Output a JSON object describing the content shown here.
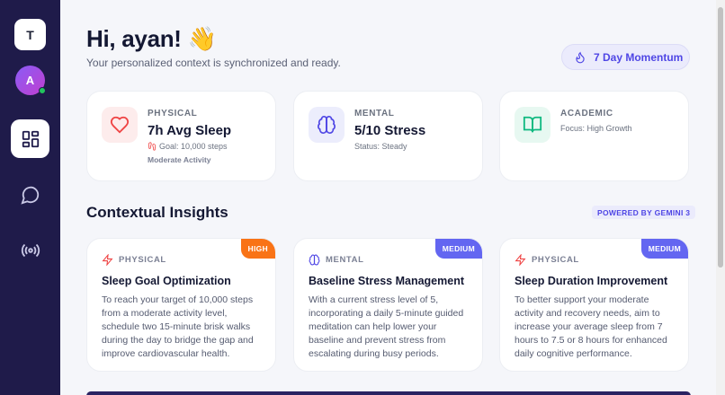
{
  "sidebar": {
    "logo_letter": "T",
    "avatar_letter": "A"
  },
  "header": {
    "greeting": "Hi, ayan! 👋",
    "subtitle": "Your personalized context is synchronized and ready.",
    "momentum_label": "7 Day Momentum"
  },
  "context_cards": [
    {
      "category": "PHYSICAL",
      "title": "7h Avg Sleep",
      "detail": "Goal: 10,000 steps",
      "note": "Moderate Activity",
      "icon": "heart-icon",
      "accent": "#ef4444"
    },
    {
      "category": "MENTAL",
      "title": "5/10 Stress",
      "detail": "Status: Steady",
      "icon": "brain-icon",
      "accent": "#4f46e5"
    },
    {
      "category": "ACADEMIC",
      "detail": "Focus: High Growth",
      "icon": "book-icon",
      "accent": "#10b981"
    }
  ],
  "insights": {
    "title": "Contextual Insights",
    "powered_by": "POWERED BY GEMINI 3",
    "cards": [
      {
        "category": "PHYSICAL",
        "priority": "HIGH",
        "priority_color": "#f97316",
        "title": "Sleep Goal Optimization",
        "body": "To reach your target of 10,000 steps from a moderate activity level, schedule two 15-minute brisk walks during the day to bridge the gap and improve cardiovascular health.",
        "icon": "lightning-icon"
      },
      {
        "category": "MENTAL",
        "priority": "MEDIUM",
        "priority_color": "#6366f1",
        "title": "Baseline Stress Management",
        "body": "With a current stress level of 5, incorporating a daily 5-minute guided meditation can help lower your baseline and prevent stress from escalating during busy periods.",
        "icon": "brain-icon"
      },
      {
        "category": "PHYSICAL",
        "priority": "MEDIUM",
        "priority_color": "#6366f1",
        "title": "Sleep Duration Improvement",
        "body": "To better support your moderate activity and recovery needs, aim to increase your average sleep from 7 hours to 7.5 or 8 hours for enhanced daily cognitive performance.",
        "icon": "lightning-icon"
      }
    ]
  }
}
